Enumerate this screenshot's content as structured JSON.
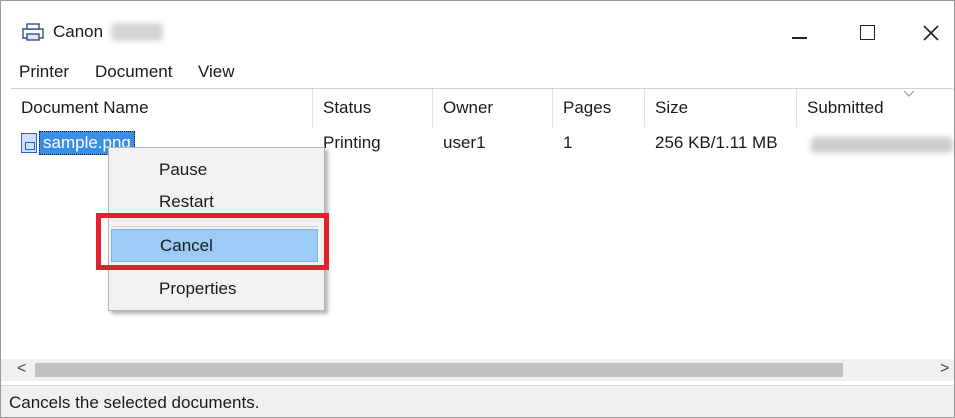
{
  "window": {
    "title": "Canon",
    "minimize_icon": "minimize-icon",
    "maximize_icon": "maximize-icon",
    "close_icon": "close-icon"
  },
  "menu": [
    "Printer",
    "Document",
    "View"
  ],
  "columns": [
    "Document Name",
    "Status",
    "Owner",
    "Pages",
    "Size",
    "Submitted"
  ],
  "rows": [
    {
      "document_name": "sample.png",
      "status": "Printing",
      "owner": "user1",
      "pages": "1",
      "size": "256 KB/1.11 MB"
    }
  ],
  "context_menu": {
    "items": [
      "Pause",
      "Restart",
      "Cancel",
      "Properties"
    ],
    "highlighted": "Cancel"
  },
  "status_bar": {
    "text": "Cancels the selected documents."
  },
  "colors": {
    "selection": "#3a8ee6",
    "menu_hover": "#9ccbf5",
    "callout_red": "#e4202a"
  }
}
